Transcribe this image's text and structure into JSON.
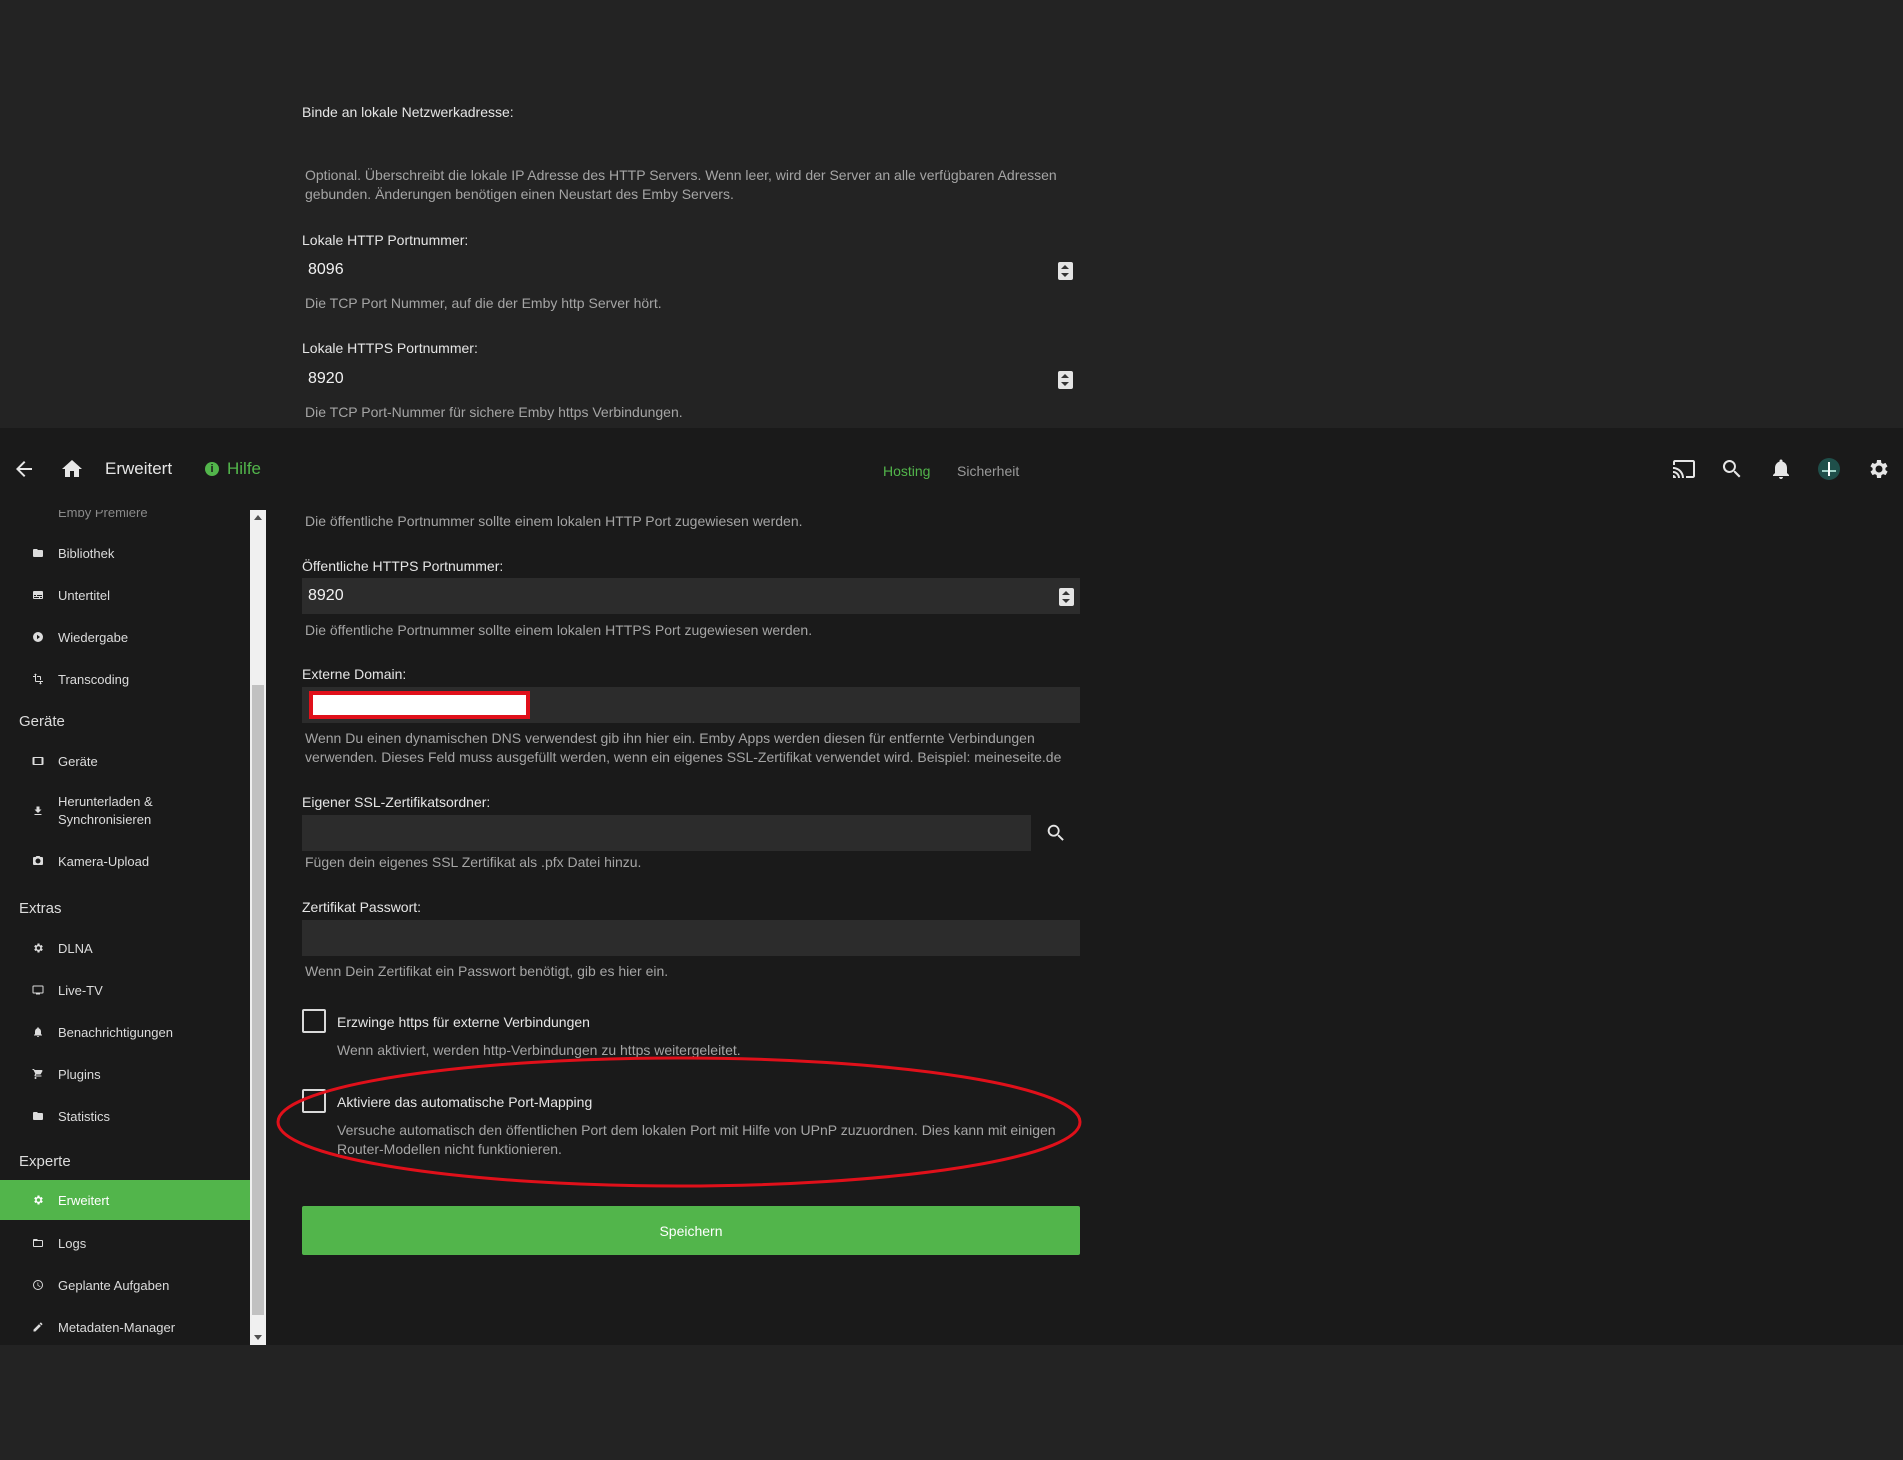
{
  "top_section": {
    "bind_address_label": "Binde an lokale Netzwerkadresse:",
    "bind_address_desc": "Optional. Überschreibt die lokale IP Adresse des HTTP Servers. Wenn leer, wird der Server an alle verfügbaren Adressen gebunden. Änderungen benötigen einen Neustart des Emby Servers.",
    "http_port_label": "Lokale HTTP Portnummer:",
    "http_port_value": "8096",
    "http_port_desc": "Die TCP Port Nummer, auf die der Emby http Server hört.",
    "https_port_label": "Lokale HTTPS Portnummer:",
    "https_port_value": "8920",
    "https_port_desc": "Die TCP Port-Nummer für sichere Emby https Verbindungen."
  },
  "header": {
    "title": "Erweitert",
    "help": "Hilfe",
    "tabs": [
      "Hosting",
      "Sicherheit"
    ],
    "icons": [
      "back-arrow-icon",
      "home-icon",
      "cast-icon",
      "search-icon",
      "bell-icon",
      "avatar",
      "gear-icon"
    ]
  },
  "sidebar": {
    "partial_item": "Emby Premiere",
    "items_a": [
      {
        "label": "Bibliothek",
        "icon": "folder-icon"
      },
      {
        "label": "Untertitel",
        "icon": "subtitles-icon"
      },
      {
        "label": "Wiedergabe",
        "icon": "play-circle-icon"
      },
      {
        "label": "Transcoding",
        "icon": "transform-icon"
      }
    ],
    "head_devices": "Geräte",
    "items_b": [
      {
        "label": "Geräte",
        "icon": "tablet-icon"
      },
      {
        "label": "Herunterladen & Synchronisieren",
        "icon": "download-icon"
      },
      {
        "label": "Kamera-Upload",
        "icon": "camera-icon"
      }
    ],
    "head_extras": "Extras",
    "items_c": [
      {
        "label": "DLNA",
        "icon": "gear-icon"
      },
      {
        "label": "Live-TV",
        "icon": "tv-icon"
      },
      {
        "label": "Benachrichtigungen",
        "icon": "bell-icon"
      },
      {
        "label": "Plugins",
        "icon": "cart-icon"
      },
      {
        "label": "Statistics",
        "icon": "folder-icon"
      }
    ],
    "head_expert": "Experte",
    "items_d": [
      {
        "label": "Erweitert",
        "icon": "gear-icon",
        "active": true
      },
      {
        "label": "Logs",
        "icon": "folder-open-icon"
      },
      {
        "label": "Geplante Aufgaben",
        "icon": "clock-icon"
      },
      {
        "label": "Metadaten-Manager",
        "icon": "pencil-icon"
      }
    ]
  },
  "main": {
    "public_http_desc": "Die öffentliche Portnummer sollte einem lokalen HTTP Port zugewiesen werden.",
    "public_https_label": "Öffentliche HTTPS Portnummer:",
    "public_https_value": "8920",
    "public_https_desc": "Die öffentliche Portnummer sollte einem lokalen HTTPS Port zugewiesen werden.",
    "domain_label": "Externe Domain:",
    "domain_desc": "Wenn Du einen dynamischen DNS verwendest gib ihn hier ein. Emby Apps werden diesen für entfernte Verbindungen verwenden. Dieses Feld muss ausgefüllt werden, wenn ein eigenes SSL-Zertifikat verwendet wird. Beispiel: meineseite.de",
    "cert_folder_label": "Eigener SSL-Zertifikatsordner:",
    "cert_folder_desc": "Fügen dein eigenes SSL Zertifikat als .pfx Datei hinzu.",
    "cert_password_label": "Zertifikat Passwort:",
    "cert_password_desc": "Wenn Dein Zertifikat ein Passwort benötigt, gib es hier ein.",
    "force_https_label": "Erzwinge https für externe Verbindungen",
    "force_https_desc": "Wenn aktiviert, werden http-Verbindungen zu https weitergeleitet.",
    "upnp_label": "Aktiviere das automatische Port-Mapping",
    "upnp_desc": "Versuche automatisch den öffentlichen Port dem lokalen Port mit Hilfe von UPnP zuzuordnen. Dies kann mit einigen Router-Modellen nicht funktionieren.",
    "save_label": "Speichern"
  },
  "colors": {
    "accent": "#52b54b",
    "annotation_red": "#e0101a",
    "background": "#1a1a1a"
  }
}
